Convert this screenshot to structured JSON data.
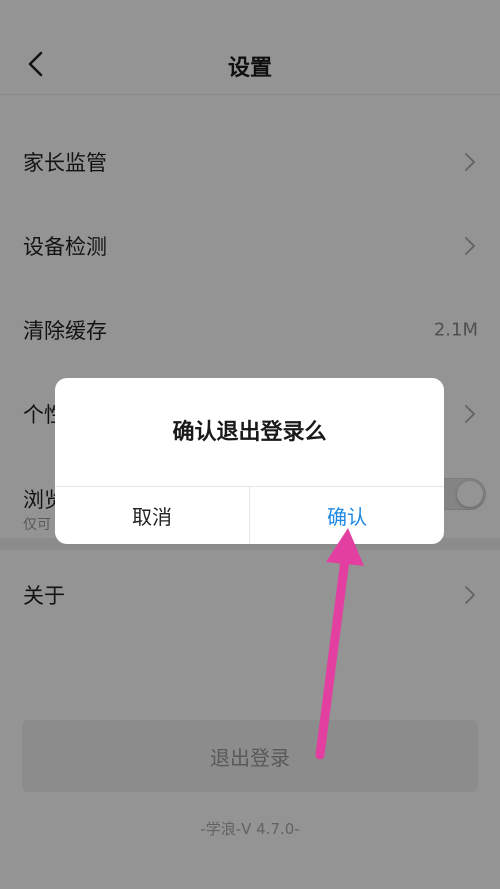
{
  "header": {
    "title": "设置",
    "back_icon": "chevron-left-icon"
  },
  "settings": {
    "parental_control": "家长监管",
    "device_check": "设备检测",
    "clear_cache": {
      "label": "清除缓存",
      "value": "2.1M"
    },
    "personal": "个性",
    "browse": {
      "label": "浏览",
      "sub": "仅可"
    },
    "about": "关于"
  },
  "logout": {
    "label": "退出登录"
  },
  "version": "-学浪-V 4.7.0-",
  "dialog": {
    "title": "确认退出登录么",
    "cancel": "取消",
    "confirm": "确认"
  },
  "colors": {
    "confirm": "#1e88e5",
    "arrow": "#e23fa1",
    "overlay": "#000000"
  }
}
